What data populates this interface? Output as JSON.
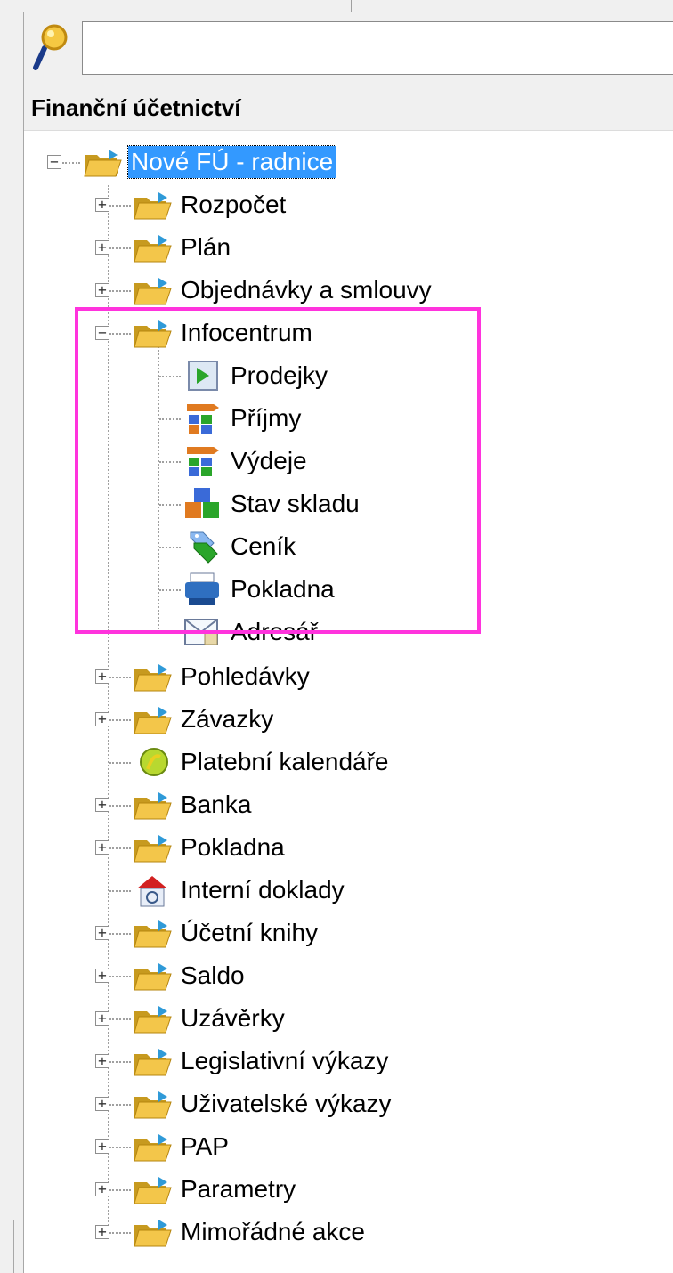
{
  "search": {
    "value": "",
    "placeholder": ""
  },
  "panel": {
    "title": "Finanční účetnictví"
  },
  "tree": {
    "root": {
      "label": "Nové FÚ - radnice",
      "icon": "folder-open-icon"
    },
    "items": [
      {
        "label": "Rozpočet",
        "icon": "folder-open-icon",
        "expander": "+"
      },
      {
        "label": "Plán",
        "icon": "folder-open-icon",
        "expander": "+"
      },
      {
        "label": "Objednávky a smlouvy",
        "icon": "folder-open-icon",
        "expander": "+"
      },
      {
        "label": "Infocentrum",
        "icon": "folder-open-icon",
        "expander": "−"
      },
      {
        "label": "Pohledávky",
        "icon": "folder-open-icon",
        "expander": "+"
      },
      {
        "label": "Závazky",
        "icon": "folder-open-icon",
        "expander": "+"
      },
      {
        "label": "Platební kalendáře",
        "icon": "calendar-icon",
        "expander": ""
      },
      {
        "label": "Banka",
        "icon": "folder-open-icon",
        "expander": "+"
      },
      {
        "label": "Pokladna",
        "icon": "folder-open-icon",
        "expander": "+"
      },
      {
        "label": "Interní doklady",
        "icon": "house-icon",
        "expander": ""
      },
      {
        "label": "Účetní knihy",
        "icon": "folder-open-icon",
        "expander": "+"
      },
      {
        "label": "Saldo",
        "icon": "folder-open-icon",
        "expander": "+"
      },
      {
        "label": "Uzávěrky",
        "icon": "folder-open-icon",
        "expander": "+"
      },
      {
        "label": "Legislativní výkazy",
        "icon": "folder-open-icon",
        "expander": "+"
      },
      {
        "label": "Uživatelské výkazy",
        "icon": "folder-open-icon",
        "expander": "+"
      },
      {
        "label": "PAP",
        "icon": "folder-open-icon",
        "expander": "+"
      },
      {
        "label": "Parametry",
        "icon": "folder-open-icon",
        "expander": "+"
      },
      {
        "label": "Mimořádné akce",
        "icon": "folder-open-icon",
        "expander": "+"
      }
    ],
    "infocentrum_children": [
      {
        "label": "Prodejky",
        "icon": "receipt-icon"
      },
      {
        "label": "Příjmy",
        "icon": "stock-in-icon"
      },
      {
        "label": "Výdeje",
        "icon": "stock-out-icon"
      },
      {
        "label": "Stav skladu",
        "icon": "stock-status-icon"
      },
      {
        "label": "Ceník",
        "icon": "price-tag-icon"
      },
      {
        "label": "Pokladna",
        "icon": "cash-register-icon"
      },
      {
        "label": "Adresář",
        "icon": "address-book-icon"
      }
    ]
  },
  "colors": {
    "selection": "#3399ff",
    "highlight_border": "#ff33dd"
  }
}
